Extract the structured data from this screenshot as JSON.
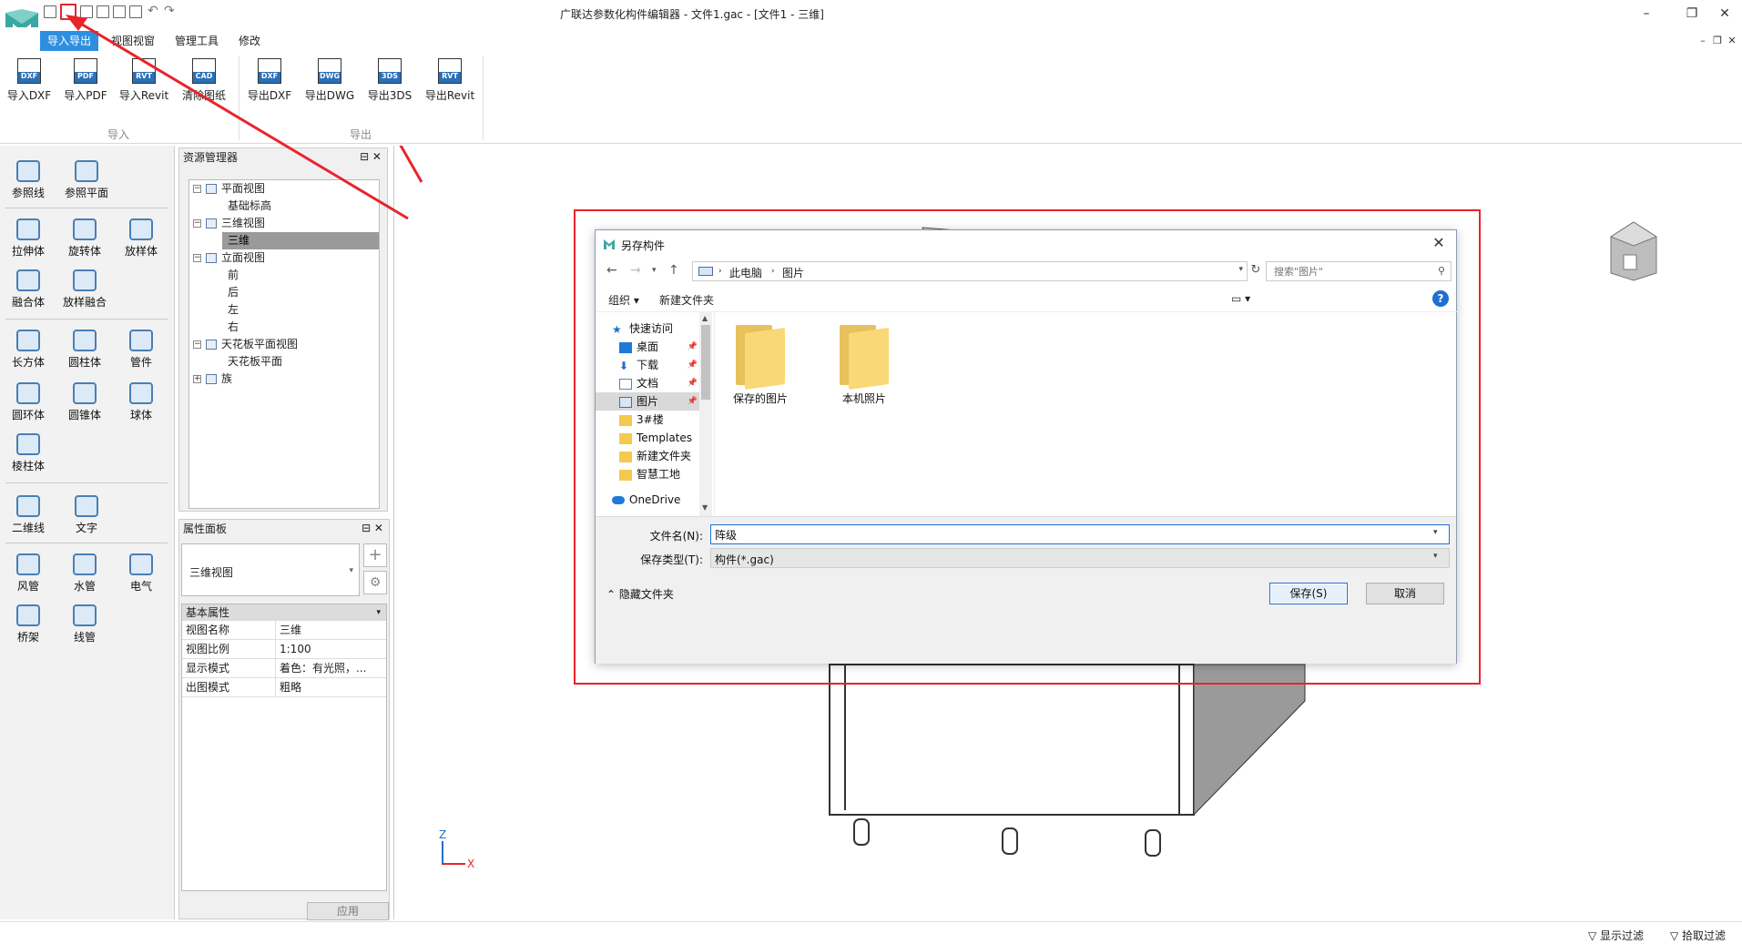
{
  "window": {
    "title": "广联达参数化构件编辑器 - 文件1.gac - [文件1 - 三维]"
  },
  "ribbon": {
    "tabs": [
      {
        "label": "导入导出",
        "active": true
      },
      {
        "label": "视图视窗",
        "active": false
      },
      {
        "label": "管理工具",
        "active": false
      },
      {
        "label": "修改",
        "active": false
      }
    ],
    "import_group": {
      "label": "导入",
      "buttons": [
        {
          "label": "导入DXF",
          "badge": "DXF"
        },
        {
          "label": "导入PDF",
          "badge": "PDF"
        },
        {
          "label": "导入Revit",
          "badge": "RVT"
        },
        {
          "label": "清除图纸",
          "badge": "CAD"
        }
      ]
    },
    "export_group": {
      "label": "导出",
      "buttons": [
        {
          "label": "导出DXF",
          "badge": "DXF"
        },
        {
          "label": "导出DWG",
          "badge": "DWG"
        },
        {
          "label": "导出3DS",
          "badge": "3DS"
        },
        {
          "label": "导出Revit",
          "badge": "RVT"
        }
      ]
    }
  },
  "tools": {
    "items": [
      {
        "label": "参照线"
      },
      {
        "label": "参照平面"
      },
      {
        "label": "拉伸体"
      },
      {
        "label": "旋转体"
      },
      {
        "label": "放样体"
      },
      {
        "label": "融合体"
      },
      {
        "label": "放样融合"
      },
      {
        "label": "长方体"
      },
      {
        "label": "圆柱体"
      },
      {
        "label": "管件"
      },
      {
        "label": "圆环体"
      },
      {
        "label": "圆锥体"
      },
      {
        "label": "球体"
      },
      {
        "label": "棱柱体"
      },
      {
        "label": "二维线"
      },
      {
        "label": "文字"
      },
      {
        "label": "风管"
      },
      {
        "label": "水管"
      },
      {
        "label": "电气"
      },
      {
        "label": "桥架"
      },
      {
        "label": "线管"
      }
    ]
  },
  "resource_manager": {
    "title": "资源管理器",
    "tree": [
      {
        "label": "平面视图",
        "level": 0,
        "box": "−"
      },
      {
        "label": "基础标高",
        "level": 1
      },
      {
        "label": "三维视图",
        "level": 0,
        "box": "−"
      },
      {
        "label": "三维",
        "level": 1,
        "selected": true
      },
      {
        "label": "立面视图",
        "level": 0,
        "box": "−"
      },
      {
        "label": "前",
        "level": 1
      },
      {
        "label": "后",
        "level": 1
      },
      {
        "label": "左",
        "level": 1
      },
      {
        "label": "右",
        "level": 1
      },
      {
        "label": "天花板平面视图",
        "level": 0,
        "box": "−"
      },
      {
        "label": "天花板平面",
        "level": 1
      },
      {
        "label": "族",
        "level": 0,
        "box": "+"
      }
    ]
  },
  "properties": {
    "title": "属性面板",
    "view_type": "三维视图",
    "group_label": "基本属性",
    "rows": [
      {
        "key": "视图名称",
        "value": "三维"
      },
      {
        "key": "视图比例",
        "value": "1:100"
      },
      {
        "key": "显示模式",
        "value": "着色：有光照，..."
      },
      {
        "key": "出图模式",
        "value": "粗略"
      }
    ],
    "apply_label": "应用"
  },
  "status": {
    "show_filter": "显示过滤",
    "pick_filter": "拾取过滤"
  },
  "dialog": {
    "title": "另存构件",
    "breadcrumb": [
      "此电脑",
      "图片"
    ],
    "search_placeholder": "搜索\"图片\"",
    "organize_label": "组织 ▾",
    "new_folder_label": "新建文件夹",
    "nav_items": [
      {
        "label": "快速访问",
        "icon": "star-icon",
        "pinned": false,
        "indent": 0
      },
      {
        "label": "桌面",
        "icon": "desktop-icon",
        "pinned": true,
        "indent": 1
      },
      {
        "label": "下载",
        "icon": "download-icon",
        "pinned": true,
        "indent": 1
      },
      {
        "label": "文档",
        "icon": "document-icon",
        "pinned": true,
        "indent": 1
      },
      {
        "label": "图片",
        "icon": "pictures-icon",
        "pinned": true,
        "indent": 1,
        "selected": true
      },
      {
        "label": "3#楼",
        "icon": "folder-icon",
        "pinned": false,
        "indent": 1
      },
      {
        "label": "Templates",
        "icon": "folder-icon",
        "pinned": false,
        "indent": 1
      },
      {
        "label": "新建文件夹",
        "icon": "folder-icon",
        "pinned": false,
        "indent": 1
      },
      {
        "label": "智慧工地",
        "icon": "folder-icon",
        "pinned": false,
        "indent": 1
      },
      {
        "label": "OneDrive",
        "icon": "cloud-icon",
        "pinned": false,
        "indent": 0
      }
    ],
    "folders": [
      {
        "label": "保存的图片"
      },
      {
        "label": "本机照片"
      }
    ],
    "filename_label": "文件名(N):",
    "filename_value": "阵级",
    "filetype_label": "保存类型(T):",
    "filetype_value": "构件(*.gac)",
    "hide_folders_label": "隐藏文件夹",
    "save_label": "保存(S)",
    "cancel_label": "取消"
  },
  "viewport": {
    "axis_z": "Z",
    "axis_x": "X"
  },
  "colors": {
    "accent": "#2e8fe0",
    "highlight_red": "#e8242b"
  }
}
